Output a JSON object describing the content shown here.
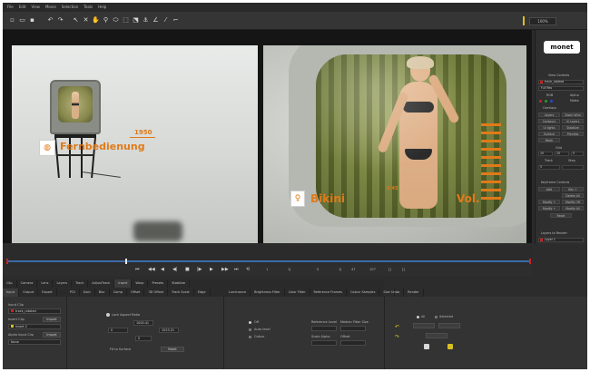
{
  "menu": [
    "File",
    "Edit",
    "View",
    "Movie",
    "Selection",
    "Tools",
    "Help"
  ],
  "toolbar": {
    "zoom": "100%"
  },
  "colors": {
    "orange": "#e07a18",
    "selection_red": "#cc2222",
    "accent_yellow": "#d8c020"
  },
  "viewer_left": {
    "year": "1950",
    "caption": "Fernbedienung",
    "icon": "wifi-remote-icon"
  },
  "viewer_right": {
    "caption_left": "Bikini",
    "caption_right": "Vol.",
    "small_number": "5:45",
    "icon": "bikini-figure-icon"
  },
  "right_panel": {
    "logo": "monet",
    "view_controls": "View Controls",
    "layer_name": "track_rotated",
    "full_res": "Full Res",
    "row1": [
      "RGB",
      "Alpha"
    ],
    "row2": [
      "Matte"
    ],
    "overlays": "Overlays",
    "rows": [
      [
        "Layers",
        "Zoom Wnd"
      ],
      [
        "Contours",
        "Ui Layers"
      ],
      [
        "Ui lights",
        "Stabilize"
      ],
      [
        "Surface",
        "Preview"
      ],
      [
        "Mesh",
        ""
      ]
    ],
    "grid": "Grid",
    "nums": [
      "10",
      "10",
      "0"
    ],
    "track": "Track",
    "step": "Step",
    "step_val": "5",
    "keyframe_controls": "Keyframe Controls",
    "kf": [
      [
        "Add",
        "Key +"
      ],
      [
        "",
        "Delete All"
      ],
      [
        "Modify +",
        "Modify Off"
      ],
      [
        "Modify +",
        "Modify All"
      ]
    ],
    "reset": "Reset",
    "layers_to_render": "Layers to Render",
    "layer_item": "Layer 1"
  },
  "transport": {
    "buttons": [
      "⏮",
      "◀◀",
      "◀",
      "◀|",
      "■",
      "|▶",
      "▶",
      "▶▶",
      "⏭",
      "⟲"
    ],
    "fields": [
      "1",
      "1|",
      "0",
      "1|",
      "47",
      "107"
    ],
    "brackets": [
      "[]",
      "[]"
    ]
  },
  "tabs_top": [
    "Clip",
    "Camera",
    "Lens",
    "Layers",
    "Track",
    "AdjustTrack",
    "Insert",
    "Warp",
    "Presets",
    "Stabilize"
  ],
  "tabs_mid": [
    "Input",
    "Output",
    "Export"
  ],
  "tabs_mid2": [
    "POI",
    "Gain",
    "Blur",
    "Comp",
    "Offset",
    "3D Offset",
    "Track Scale",
    "Edge"
  ],
  "tabs_right": [
    "Luminance",
    "Brightness Filter",
    "Color Filter",
    "Reference Frames",
    "Colour Samples",
    "Size"
  ],
  "tabs_undo": [
    "Undo",
    "Render"
  ],
  "props": {
    "input_clip": "Input Clip",
    "input_clip_value": "track_rotated",
    "insert_clip": "Insert Clip",
    "insert_btn": "Import",
    "insert_value": "Insert 2",
    "alpha_input": "Alpha Input Clip",
    "alpha_value": "None",
    "lock_ratio": "Lock Aspect Ratio",
    "w_value": "1000.41",
    "w_value2": "1023.21",
    "v1": "0",
    "v2": "0",
    "fit": "Fit to Surface",
    "reset": "Reset",
    "off": "Off",
    "auto_level": "Auto level",
    "colour": "Colour",
    "ref_level": "Reference Level",
    "median": "Median Filter Size",
    "scale_alpha": "Scale Alpha",
    "offset": "Offset",
    "all": "All",
    "selected": "Selected"
  }
}
